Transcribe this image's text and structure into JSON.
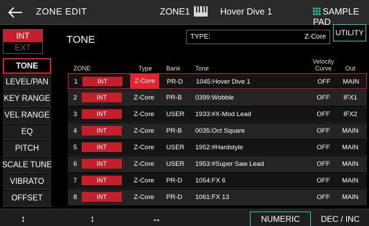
{
  "header": {
    "title": "ZONE EDIT",
    "zone": "ZONE1",
    "tone_name": "Hover Dive 1",
    "sample_pad": "SAMPLE PAD"
  },
  "source": {
    "int": "INT",
    "ext": "EXT"
  },
  "page_title": "TONE",
  "type_box": {
    "label": "TYPE:",
    "value": "Z-Core"
  },
  "utility": "UTILITY",
  "menu": [
    "TONE",
    "LEVEL/PAN",
    "KEY RANGE",
    "VEL RANGE",
    "EQ",
    "PITCH",
    "SCALE TUNE",
    "VIBRATO",
    "OFFSET"
  ],
  "table": {
    "headers": {
      "zone": "ZONE",
      "type": "Type",
      "bank": "Bank",
      "tone": "Tone",
      "velocity_curve_1": "Velocity",
      "velocity_curve_2": "Curve",
      "out": "Out"
    },
    "rows": [
      {
        "idx": "1",
        "src": "INT",
        "type": "Z-Core",
        "bank": "PR-D",
        "tone": "1045:Hover Dive 1",
        "vel": "OFF",
        "out": "MAIN"
      },
      {
        "idx": "2",
        "src": "INT",
        "type": "Z-Core",
        "bank": "PR-B",
        "tone": "0399:Wobble",
        "vel": "OFF",
        "out": "IFX1"
      },
      {
        "idx": "3",
        "src": "INT",
        "type": "Z-Core",
        "bank": "USER",
        "tone": "1933:#X-Mod Lead",
        "vel": "OFF",
        "out": "IFX2"
      },
      {
        "idx": "4",
        "src": "INT",
        "type": "Z-Core",
        "bank": "PR-B",
        "tone": "0035:Oct Square",
        "vel": "OFF",
        "out": "MAIN"
      },
      {
        "idx": "5",
        "src": "INT",
        "type": "Z-Core",
        "bank": "USER",
        "tone": "1952:#Hardstyle",
        "vel": "OFF",
        "out": "MAIN"
      },
      {
        "idx": "6",
        "src": "INT",
        "type": "Z-Core",
        "bank": "USER",
        "tone": "1953:#Super Saw Lead",
        "vel": "OFF",
        "out": "MAIN"
      },
      {
        "idx": "7",
        "src": "INT",
        "type": "Z-Core",
        "bank": "PR-D",
        "tone": "1054:FX 6",
        "vel": "OFF",
        "out": "MAIN"
      },
      {
        "idx": "8",
        "src": "INT",
        "type": "Z-Core",
        "bank": "PR-D",
        "tone": "1061:FX 13",
        "vel": "OFF",
        "out": "MAIN"
      }
    ]
  },
  "bottom": {
    "icon1": "↕",
    "icon2": "↕",
    "icon3": "↔",
    "numeric": "NUMERIC",
    "dec_inc": "DEC / INC"
  },
  "colors": {
    "accent_red": "#c4202b",
    "accent_teal": "#2ec9b4",
    "pad_icon": "#19b59a"
  }
}
